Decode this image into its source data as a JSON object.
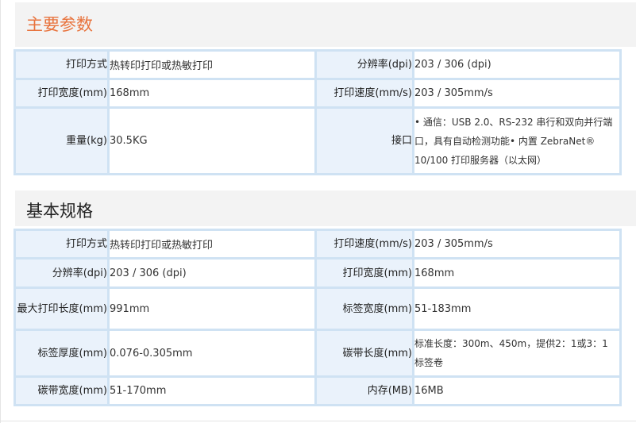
{
  "sections": [
    {
      "title": "主要参数",
      "rows": [
        {
          "label1": "打印方式",
          "value1": "热转印打印或热敏打印",
          "label2": "分辨率(dpi)",
          "value2": "203 / 306 (dpi)"
        },
        {
          "label1": "打印宽度(mm)",
          "value1": "168mm",
          "label2": "打印速度(mm/s)",
          "value2": "203 / 305mm/s"
        },
        {
          "label1": "重量(kg)",
          "value1": "30.5KG",
          "label2": "接口",
          "value2": "• 通信：USB 2.0、RS-232 串行和双向并行端口，具有自动检测功能• 内置 ZebraNet® 10/100 打印服务器（以太网）"
        }
      ]
    },
    {
      "title": "基本规格",
      "rows": [
        {
          "label1": "打印方式",
          "value1": "热转印打印或热敏打印",
          "label2": "打印速度(mm/s)",
          "value2": "203 / 305mm/s"
        },
        {
          "label1": "分辨率(dpi)",
          "value1": "203 / 306 (dpi)",
          "label2": "打印宽度(mm)",
          "value2": "168mm"
        },
        {
          "label1": "最大打印长度(mm)",
          "value1": "991mm",
          "label2": "标签宽度(mm)",
          "value2": "51-183mm"
        },
        {
          "label1": "标签厚度(mm)",
          "value1": "0.076-0.305mm",
          "label2": "碳带长度(mm)",
          "value2": "标准长度：300m、450m，提供2：1或3：1标签卷"
        },
        {
          "label1": "碳带宽度(mm)",
          "value1": "51-170mm",
          "label2": "内存(MB)",
          "value2": "16MB"
        }
      ]
    }
  ]
}
